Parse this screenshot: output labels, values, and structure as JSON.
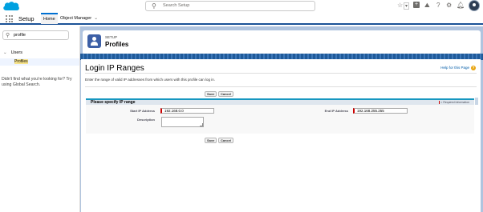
{
  "header": {
    "search_placeholder": "Search Setup",
    "icons": [
      "favorites-star-icon",
      "add-icon",
      "trailhead-icon",
      "help-icon",
      "gear-icon",
      "bell-icon"
    ]
  },
  "nav": {
    "app_name": "Setup",
    "tabs": [
      {
        "label": "Home"
      },
      {
        "label": "Object Manager"
      }
    ]
  },
  "sidebar": {
    "quick_find_value": "profile",
    "tree": {
      "group": "Users",
      "item": "Profiles"
    },
    "help_text": "Didn't find what you're looking for? Try using Global Search."
  },
  "page_header": {
    "eyebrow": "SETUP",
    "title": "Profiles"
  },
  "page": {
    "title": "Login IP Ranges",
    "help_link": "Help for this Page",
    "description": "Enter the range of valid IP addresses from which users with this profile can log in.",
    "buttons": {
      "save": "Save",
      "cancel": "Cancel"
    },
    "section": {
      "title": "Please specify IP range",
      "required_info": "= Required Information"
    },
    "fields": {
      "start_ip_label": "Start IP Address",
      "start_ip_value": "192.168.0.0",
      "end_ip_label": "End IP Address",
      "end_ip_value": "192.168.255.255",
      "description_label": "Description",
      "description_value": ""
    }
  },
  "colors": {
    "brand_blue": "#0070d2",
    "required_red": "#c00000",
    "section_accent": "#1797c0"
  }
}
